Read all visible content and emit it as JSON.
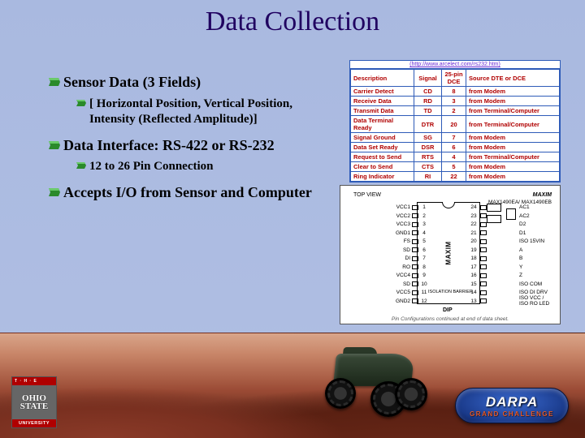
{
  "title": "Data Collection",
  "bullets": [
    {
      "level": 1,
      "text": "Sensor Data (3 Fields)"
    },
    {
      "level": 2,
      "text": "[ Horizontal Position, Vertical Position, Intensity (Reflected Amplitude)]"
    },
    {
      "level": 1,
      "text": "Data Interface: RS-422 or RS-232"
    },
    {
      "level": 2,
      "text": "12 to 26 Pin Connection"
    },
    {
      "level": 1,
      "text": "Accepts I/O from Sensor and Computer"
    }
  ],
  "signal_table": {
    "url": "(http://www.arcelect.com/rs232.htm)",
    "headers": [
      "Description",
      "Signal",
      "25-pin DCE",
      "Source DTE or DCE"
    ],
    "rows": [
      [
        "Carrier Detect",
        "CD",
        "8",
        "from Modem"
      ],
      [
        "Receive Data",
        "RD",
        "3",
        "from Modem"
      ],
      [
        "Transmit Data",
        "TD",
        "2",
        "from Terminal/Computer"
      ],
      [
        "Data Terminal Ready",
        "DTR",
        "20",
        "from Terminal/Computer"
      ],
      [
        "Signal Ground",
        "SG",
        "7",
        "from Modem"
      ],
      [
        "Data Set Ready",
        "DSR",
        "6",
        "from Modem"
      ],
      [
        "Request to Send",
        "RTS",
        "4",
        "from Terminal/Computer"
      ],
      [
        "Clear to Send",
        "CTS",
        "5",
        "from Modem"
      ],
      [
        "Ring Indicator",
        "RI",
        "22",
        "from Modem"
      ]
    ]
  },
  "chip": {
    "topview": "TOP VIEW",
    "vendor": "MAXIM",
    "part": "MAX1490EA/ MAX1490EB",
    "center": "MAXIM",
    "dip": "DIP",
    "isolation": "ISOLATION BARRIER",
    "caption": "Pin Configurations continued at end of data sheet.",
    "left_pins": [
      {
        "n": "1",
        "lbl": "VCC1"
      },
      {
        "n": "2",
        "lbl": "VCC2"
      },
      {
        "n": "3",
        "lbl": "VCC3"
      },
      {
        "n": "4",
        "lbl": "GND1"
      },
      {
        "n": "5",
        "lbl": "FS"
      },
      {
        "n": "6",
        "lbl": "SD"
      },
      {
        "n": "7",
        "lbl": "DI"
      },
      {
        "n": "8",
        "lbl": "RO"
      },
      {
        "n": "9",
        "lbl": "VCC4"
      },
      {
        "n": "10",
        "lbl": "SD"
      },
      {
        "n": "11",
        "lbl": "VCC5"
      },
      {
        "n": "12",
        "lbl": "GND2"
      }
    ],
    "right_pins": [
      {
        "n": "24",
        "lbl": "AC1"
      },
      {
        "n": "23",
        "lbl": "AC2"
      },
      {
        "n": "22",
        "lbl": "D2"
      },
      {
        "n": "21",
        "lbl": "D1"
      },
      {
        "n": "20",
        "lbl": "ISO 15VIN"
      },
      {
        "n": "19",
        "lbl": "A"
      },
      {
        "n": "18",
        "lbl": "B"
      },
      {
        "n": "17",
        "lbl": "Y"
      },
      {
        "n": "16",
        "lbl": "Z"
      },
      {
        "n": "15",
        "lbl": "ISO COM"
      },
      {
        "n": "14",
        "lbl": "ISO DI DRV"
      },
      {
        "n": "13",
        "lbl": "ISO VCC / ISO RO LED"
      }
    ]
  },
  "logos": {
    "osu_top": "T · H · E",
    "osu_mid": "OHIO\nSTATE",
    "osu_bot": "UNIVERSITY",
    "darpa_t": "DARPA",
    "darpa_b": "GRAND CHALLENGE"
  }
}
